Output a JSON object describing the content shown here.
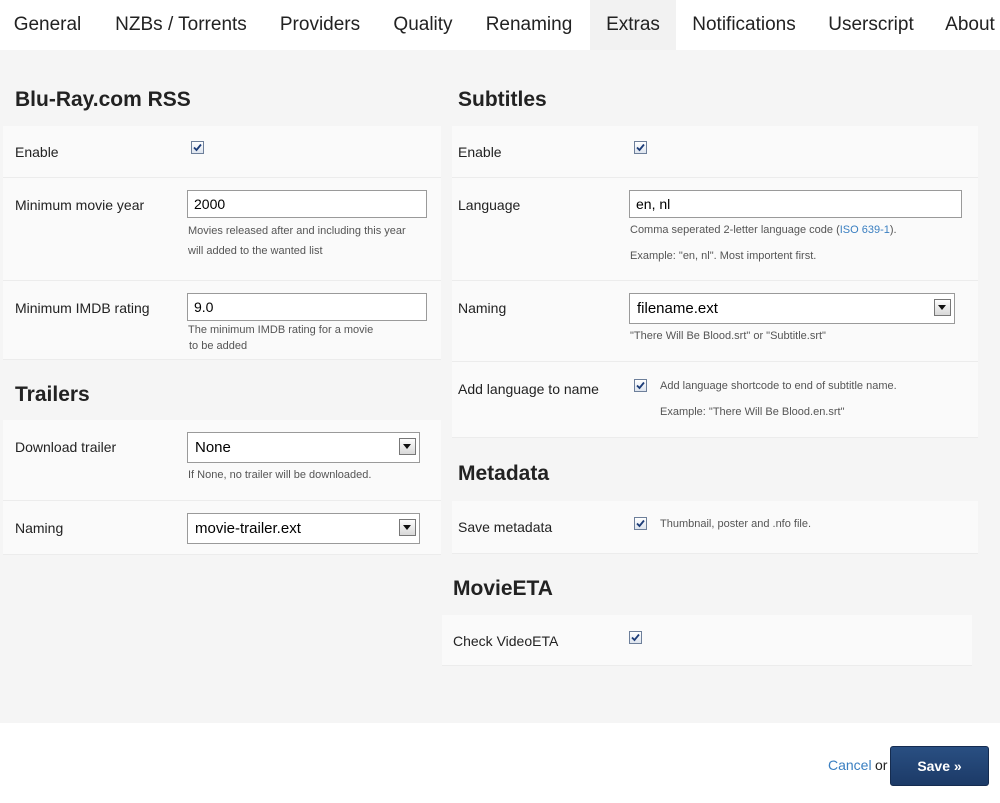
{
  "tabs": [
    "General",
    "NZBs / Torrents",
    "Providers",
    "Quality",
    "Renaming",
    "Extras",
    "Notifications",
    "Userscript",
    "About"
  ],
  "active_tab": "Extras",
  "bluray": {
    "title": "Blu-Ray.com RSS",
    "enable_label": "Enable",
    "enabled": true,
    "min_year_label": "Minimum movie year",
    "min_year_value": "2000",
    "min_year_hint_1": "Movies released after and including this year",
    "min_year_hint_2": "will added to the wanted list",
    "min_rating_label": "Minimum IMDB rating",
    "min_rating_value": "9.0",
    "min_rating_hint_1": "The minimum IMDB rating for a movie",
    "min_rating_hint_2": "to be added"
  },
  "trailers": {
    "title": "Trailers",
    "download_label": "Download trailer",
    "download_value": "None",
    "download_hint": "If None, no trailer will be downloaded.",
    "naming_label": "Naming",
    "naming_value": "movie-trailer.ext"
  },
  "subtitles": {
    "title": "Subtitles",
    "enable_label": "Enable",
    "enabled": true,
    "language_label": "Language",
    "language_value": "en, nl",
    "language_hint_prefix": "Comma seperated 2-letter language code (",
    "language_hint_link": "ISO 639-1",
    "language_hint_suffix": ").",
    "language_example": "Example: \"en, nl\". Most importent first.",
    "naming_label": "Naming",
    "naming_value": "filename.ext",
    "naming_hint": "\"There Will Be Blood.srt\" or \"Subtitle.srt\"",
    "add_lang_label": "Add language to name",
    "add_lang_checked": true,
    "add_lang_hint": "Add language shortcode to end of subtitle name.",
    "add_lang_example": "Example: \"There Will Be Blood.en.srt\""
  },
  "metadata": {
    "title": "Metadata",
    "save_label": "Save metadata",
    "save_checked": true,
    "save_hint": "Thumbnail, poster and .nfo file."
  },
  "movieeta": {
    "title": "MovieETA",
    "check_label": "Check VideoETA",
    "check_checked": true
  },
  "footer": {
    "cancel_label": "Cancel",
    "or_label": "or",
    "save_label": "Save »"
  },
  "colors": {
    "link": "#3a7fc1",
    "save_button": "#1f3f6e",
    "active_tab_bg": "#f2f2f2",
    "content_bg": "#f5f5f5"
  }
}
